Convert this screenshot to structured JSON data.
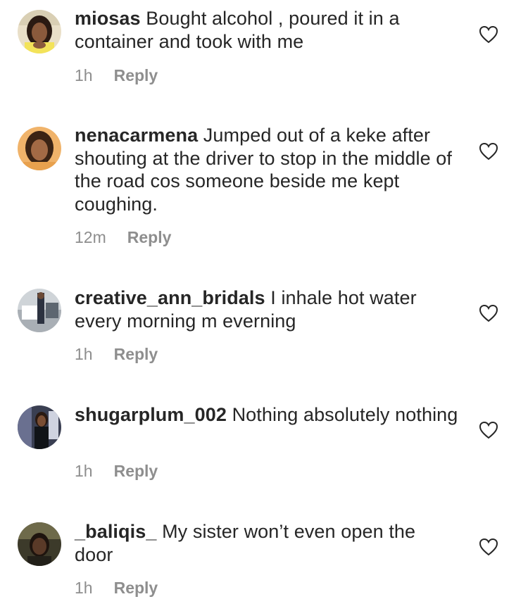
{
  "comments": [
    {
      "username": "miosas",
      "text": " Bought alcohol , poured  it in a container and took with me",
      "time": "1h",
      "reply_label": "Reply",
      "avatar_icon": "user-avatar-photo"
    },
    {
      "username": "nenacarmena",
      "text": " Jumped out of a keke after shouting at the driver to stop in the middle of the road cos someone beside me kept coughing.",
      "time": "12m",
      "reply_label": "Reply",
      "avatar_icon": "user-avatar-photo"
    },
    {
      "username": "creative_ann_bridals",
      "text": " I inhale hot water every morning m everning",
      "time": "1h",
      "reply_label": "Reply",
      "avatar_icon": "user-avatar-photo"
    },
    {
      "username": "shugarplum_002",
      "text": " Nothing absolutely nothing",
      "time": "1h",
      "reply_label": "Reply",
      "avatar_icon": "user-avatar-photo"
    },
    {
      "username": "_baliqis_",
      "text": " My sister won’t even open the door",
      "time": "1h",
      "reply_label": "Reply",
      "avatar_icon": "user-avatar-photo"
    }
  ],
  "like_icon": "heart-outline-icon",
  "colors": {
    "text": "#262626",
    "meta": "#8e8e8e",
    "background": "#ffffff"
  }
}
